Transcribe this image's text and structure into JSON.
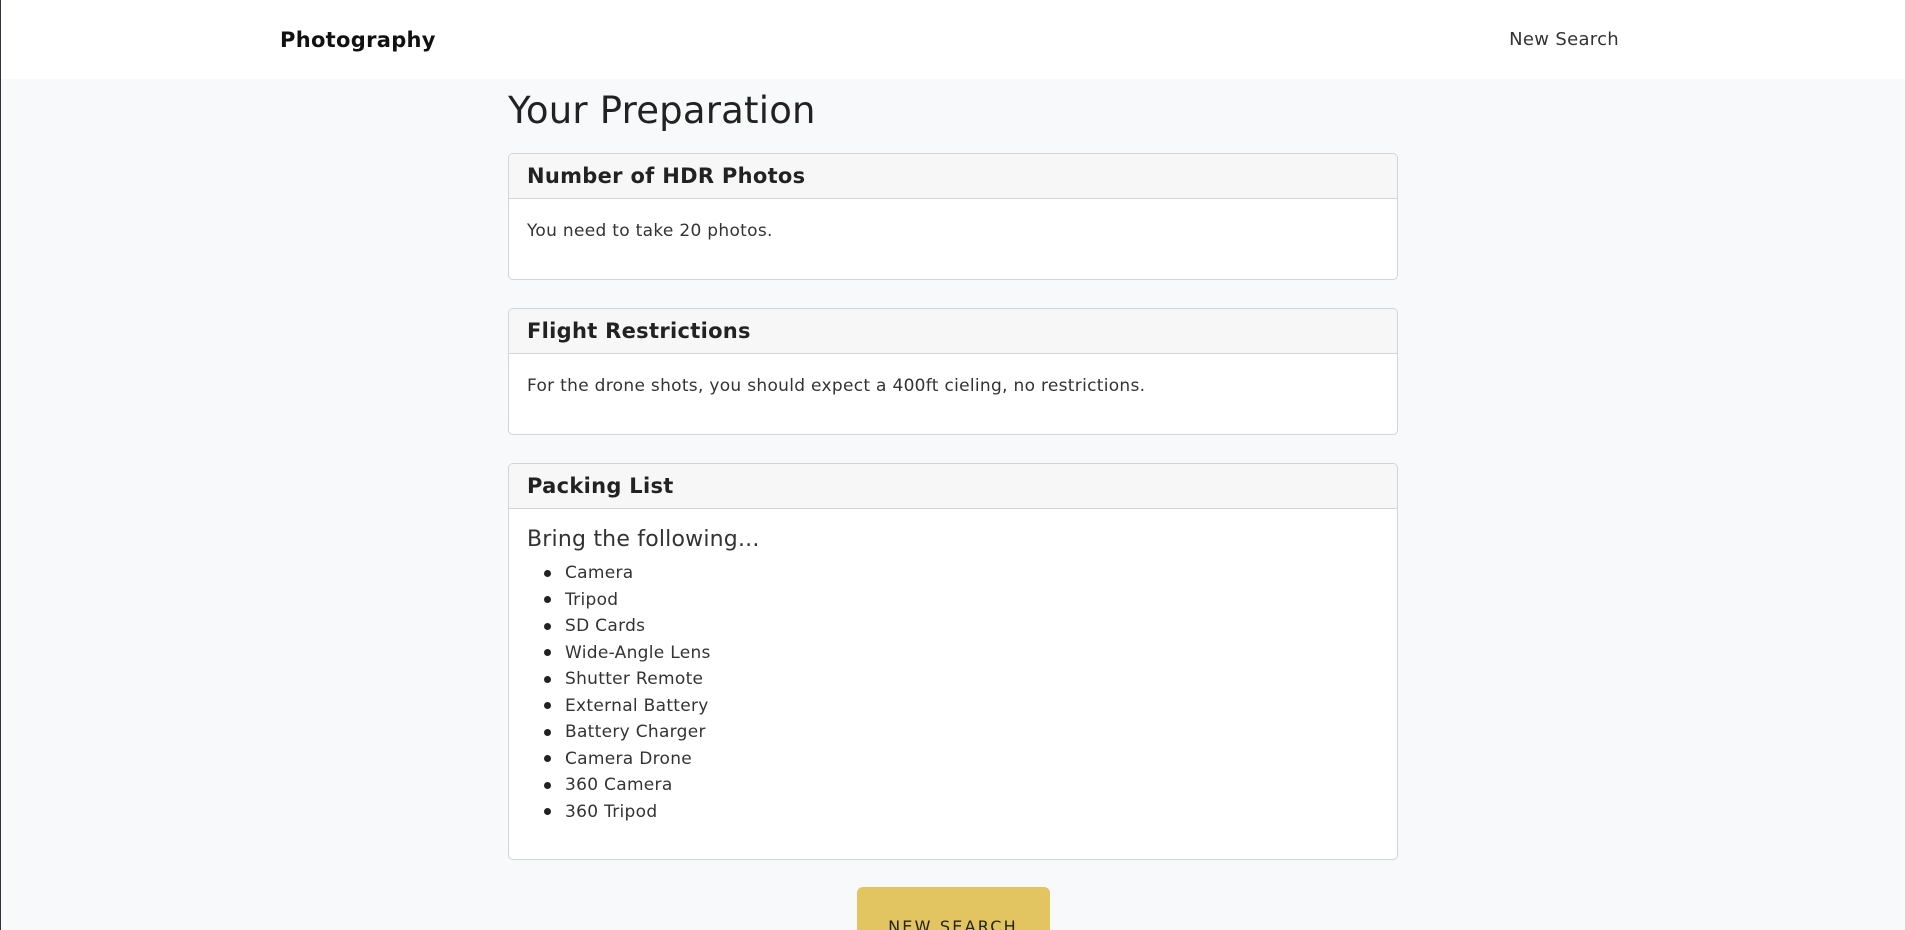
{
  "navbar": {
    "brand": "Photography",
    "new_search_link": "New Search"
  },
  "page": {
    "title": "Your Preparation"
  },
  "cards": {
    "hdr": {
      "title": "Number of HDR Photos",
      "body": "You need to take 20 photos."
    },
    "flight": {
      "title": "Flight Restrictions",
      "body": "For the drone shots, you should expect a 400ft cieling, no restrictions."
    },
    "packing": {
      "title": "Packing List",
      "intro": "Bring the following...",
      "items": [
        "Camera",
        "Tripod",
        "SD Cards",
        "Wide-Angle Lens",
        "Shutter Remote",
        "External Battery",
        "Battery Charger",
        "Camera Drone",
        "360 Camera",
        "360 Tripod"
      ]
    }
  },
  "actions": {
    "new_search_button": "NEW SEARCH"
  },
  "colors": {
    "accent": "#e2c561",
    "background": "#f8f9fa"
  }
}
